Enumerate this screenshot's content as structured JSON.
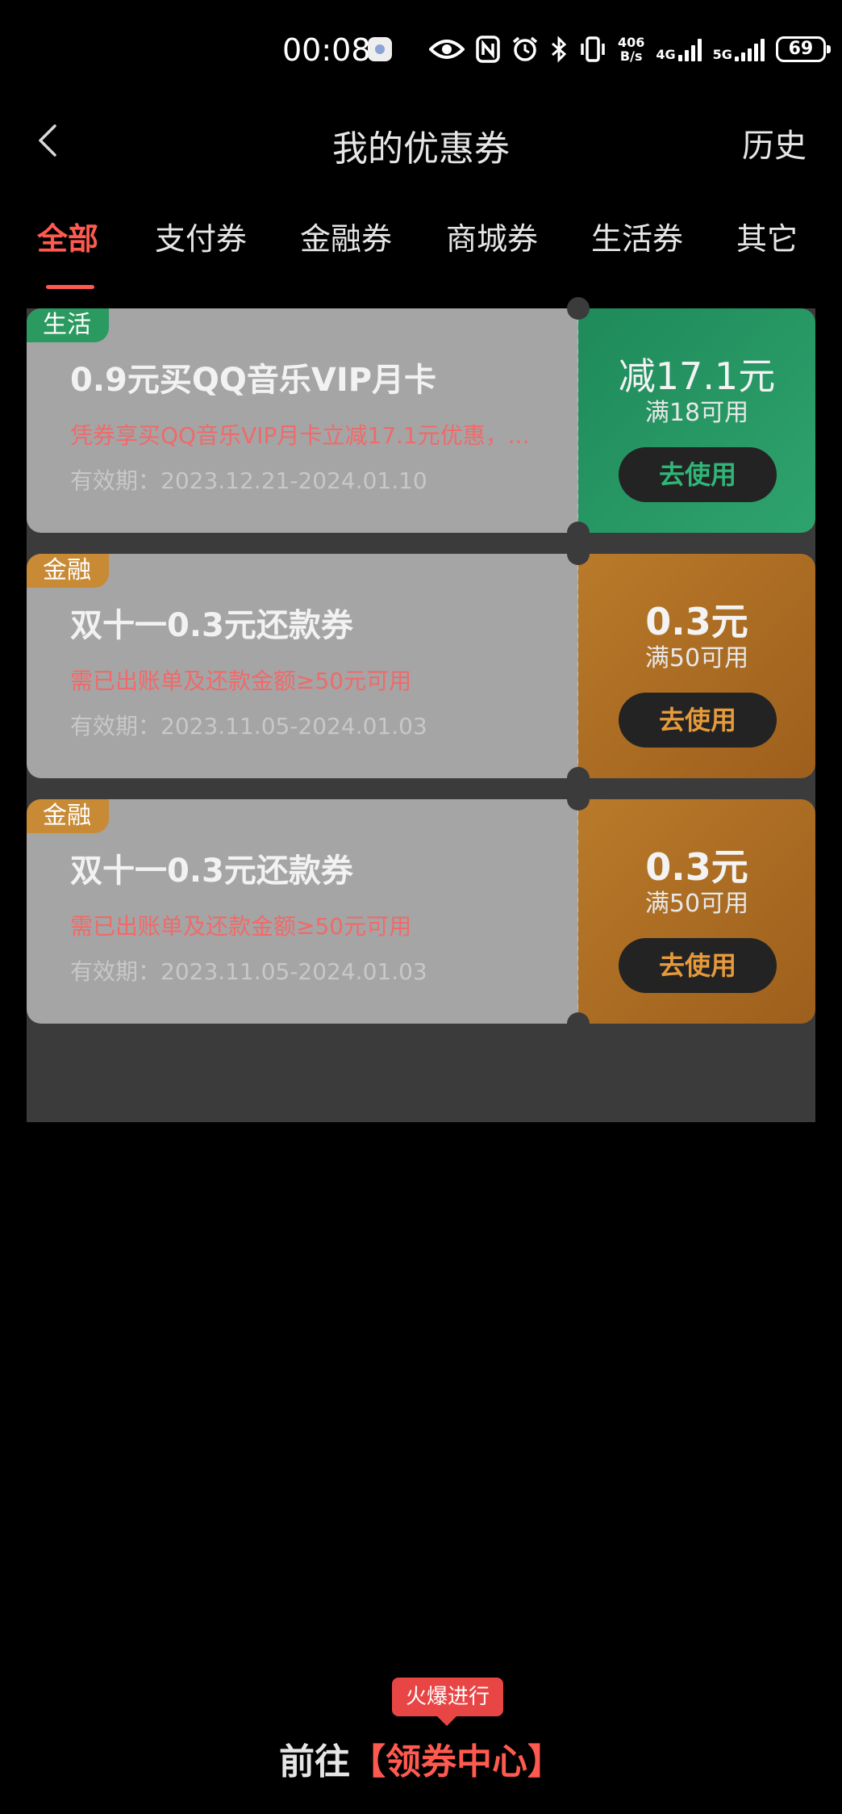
{
  "status_bar": {
    "time": "00:08",
    "net_speed_value": "406",
    "net_speed_unit": "B/s",
    "sim1": "4G",
    "sim2": "5G",
    "battery": "69"
  },
  "header": {
    "title": "我的优惠券",
    "history": "历史"
  },
  "tabs": [
    {
      "label": "全部",
      "active": true
    },
    {
      "label": "支付券",
      "active": false
    },
    {
      "label": "金融券",
      "active": false
    },
    {
      "label": "商城券",
      "active": false
    },
    {
      "label": "生活券",
      "active": false
    },
    {
      "label": "其它",
      "active": false
    }
  ],
  "coupons": [
    {
      "tag": "生活",
      "title": "0.9元买QQ音乐VIP月卡",
      "desc": "凭券享买QQ音乐VIP月卡立减17.1元优惠，...",
      "valid": "有效期：2023.12.21-2024.01.10",
      "amount": "减17.1元",
      "condition": "满18可用",
      "button": "去使用",
      "theme_color": "#2b9a61"
    },
    {
      "tag": "金融",
      "title": "双十一0.3元还款券",
      "desc": "需已出账单及还款金额≥50元可用",
      "valid": "有效期：2023.11.05-2024.01.03",
      "amount": "0.3元",
      "condition": "满50可用",
      "button": "去使用",
      "theme_color": "#c88a34"
    },
    {
      "tag": "金融",
      "title": "双十一0.3元还款券",
      "desc": "需已出账单及还款金额≥50元可用",
      "valid": "有效期：2023.11.05-2024.01.03",
      "amount": "0.3元",
      "condition": "满50可用",
      "button": "去使用",
      "theme_color": "#c88a34"
    }
  ],
  "footer": {
    "badge": "火爆进行",
    "goto_prefix": "前往",
    "goto_link": "【领券中心】"
  }
}
